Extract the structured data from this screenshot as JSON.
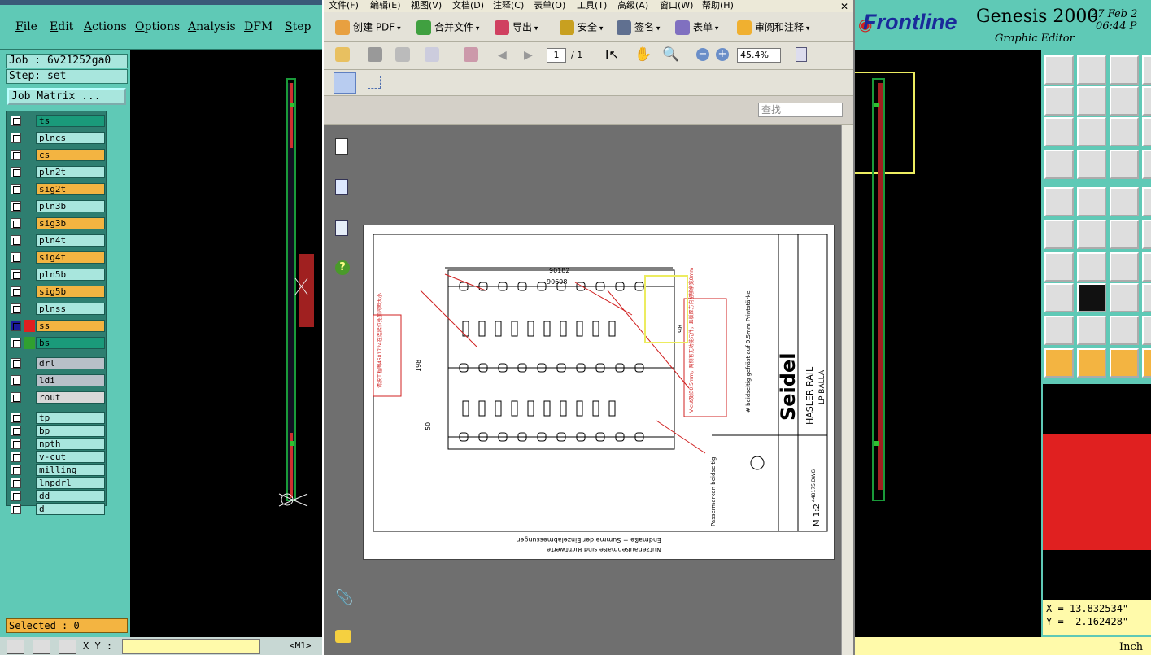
{
  "genesis_menu": [
    "File",
    "Edit",
    "Actions",
    "Options",
    "Analysis",
    "DFM",
    "Step"
  ],
  "job_label": "Job : 6v21252ga0",
  "step_label": "Step: set",
  "job_matrix_label": "Job Matrix ...",
  "layers": [
    {
      "name": "ts",
      "color": "#1a9a7a"
    },
    {
      "name": "plncs",
      "color": "#a8e6dd"
    },
    {
      "name": "cs",
      "color": "#f3b441"
    },
    {
      "name": "pln2t",
      "color": "#a8e6dd"
    },
    {
      "name": "sig2t",
      "color": "#f3b441"
    },
    {
      "name": "pln3b",
      "color": "#a8e6dd"
    },
    {
      "name": "sig3b",
      "color": "#f3b441"
    },
    {
      "name": "pln4t",
      "color": "#a8e6dd"
    },
    {
      "name": "sig4t",
      "color": "#f3b441"
    },
    {
      "name": "pln5b",
      "color": "#a8e6dd"
    },
    {
      "name": "sig5b",
      "color": "#f3b441"
    },
    {
      "name": "plnss",
      "color": "#a8e6dd"
    },
    {
      "name": "ss",
      "color": "#f3b441"
    },
    {
      "name": "bs",
      "color": "#1a9a7a"
    },
    {
      "name": "drl",
      "color": "#b8c0c8"
    },
    {
      "name": "ldi",
      "color": "#b8c0c8"
    },
    {
      "name": "rout",
      "color": "#d8d8d8"
    },
    {
      "name": "tp",
      "color": "#a8e6dd"
    },
    {
      "name": "bp",
      "color": "#a8e6dd"
    },
    {
      "name": "npth",
      "color": "#a8e6dd"
    },
    {
      "name": "v-cut",
      "color": "#a8e6dd"
    },
    {
      "name": "milling",
      "color": "#a8e6dd"
    },
    {
      "name": "lnpdrl",
      "color": "#a8e6dd"
    },
    {
      "name": "dd",
      "color": "#a8e6dd"
    },
    {
      "name": "d",
      "color": "#a8e6dd"
    }
  ],
  "selected_label": "Selected : 0",
  "xy_label": "X Y :",
  "m1_label": "<M1>",
  "acro_menu": [
    "文件(F)",
    "编辑(E)",
    "视图(V)",
    "文档(D)",
    "注释(C)",
    "表单(O)",
    "工具(T)",
    "高级(A)",
    "窗口(W)",
    "帮助(H)"
  ],
  "acro_toolbar": [
    "创建 PDF",
    "合并文件",
    "导出",
    "安全",
    "签名",
    "表单",
    "审阅和注释"
  ],
  "page_current": "1",
  "page_total": "/ 1",
  "zoom": "45.4%",
  "find_placeholder": "查找",
  "frontline_logo": "Frontline",
  "genesis_title": "Genesis 2000",
  "genesis_subtitle": "Graphic Editor",
  "date_text": "27 Feb 2",
  "time_text": "06:44 P",
  "coord_x": "X = 13.832534\"",
  "coord_y": "Y = -2.162428\"",
  "units": "Inch",
  "drawing": {
    "dim1": "90182",
    "dim2": "90698",
    "dim_left": "198",
    "dim_50": "50",
    "dim_98": "98",
    "title_brand": "Seidel",
    "title_name": "HASLER RAIL",
    "title_sub": "LP BALLA",
    "scale": "M 1:2",
    "note_cn1": "V-cut及沿0.5mm，两侧有无功能元件，且板厚方向留够余宽0mm",
    "note_cn2": "请按工程图4581724在连接位处加间距大小",
    "footer1": "Endmaße = Summe der Einzelabmessungen",
    "footer2": "Nutzenaußenmaße sind Richtwerte",
    "passer": "Passermarken beidseitig",
    "text_right1": "# beidseitig gefräst auf 0.5mm Printstärke",
    "filename": "448175.DWG"
  }
}
